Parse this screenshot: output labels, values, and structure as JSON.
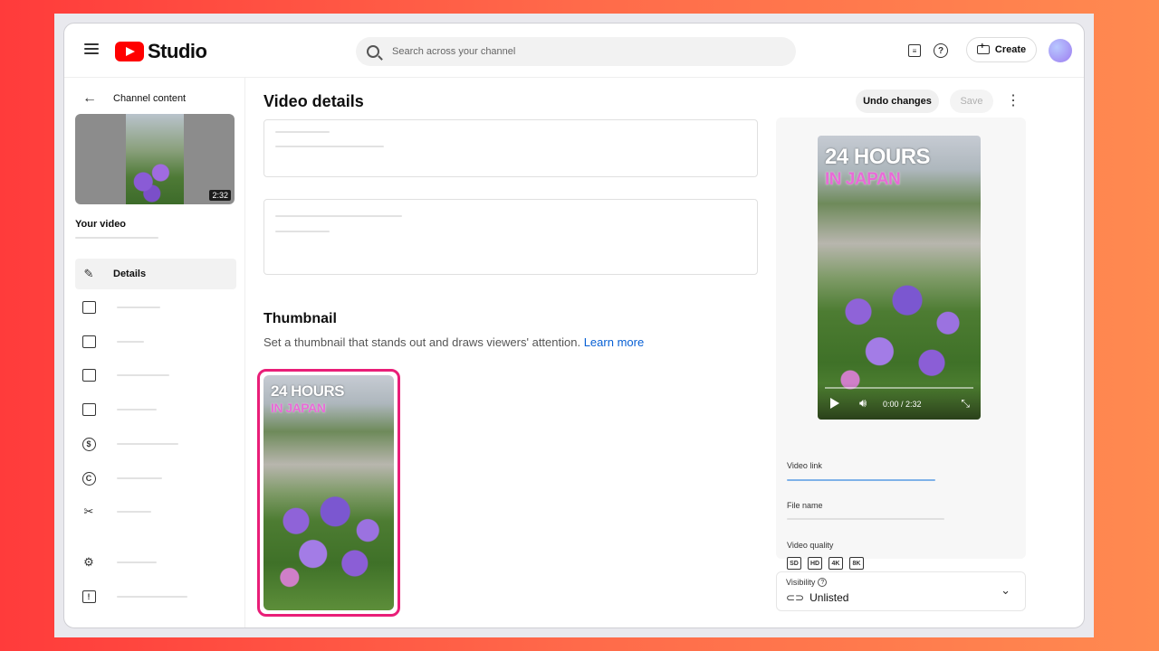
{
  "header": {
    "logo_text": "Studio",
    "search_placeholder": "Search across your channel",
    "create_label": "Create"
  },
  "sidebar": {
    "back_label": "Channel content",
    "thumbnail_duration": "2:32",
    "your_video_label": "Your video",
    "active_item_label": "Details"
  },
  "main": {
    "title": "Video details",
    "undo_label": "Undo changes",
    "save_label": "Save",
    "thumbnail": {
      "title": "Thumbnail",
      "description": "Set a thumbnail that stands out and draws viewers' attention.",
      "learn_more": "Learn more",
      "overlay_line1": "24 HOURS",
      "overlay_line2": "IN JAPAN"
    }
  },
  "preview": {
    "overlay_line1": "24 HOURS",
    "overlay_line2": "IN JAPAN",
    "time": "0:00 / 2:32",
    "video_link_label": "Video link",
    "file_name_label": "File name",
    "video_quality_label": "Video quality",
    "quality_badges": [
      "SD",
      "HD",
      "4K",
      "8K"
    ]
  },
  "visibility": {
    "label": "Visibility",
    "value": "Unlisted"
  },
  "colors": {
    "brand_red": "#ff0000",
    "thumbnail_highlight": "#e91e78",
    "link_blue": "#065fd4"
  }
}
